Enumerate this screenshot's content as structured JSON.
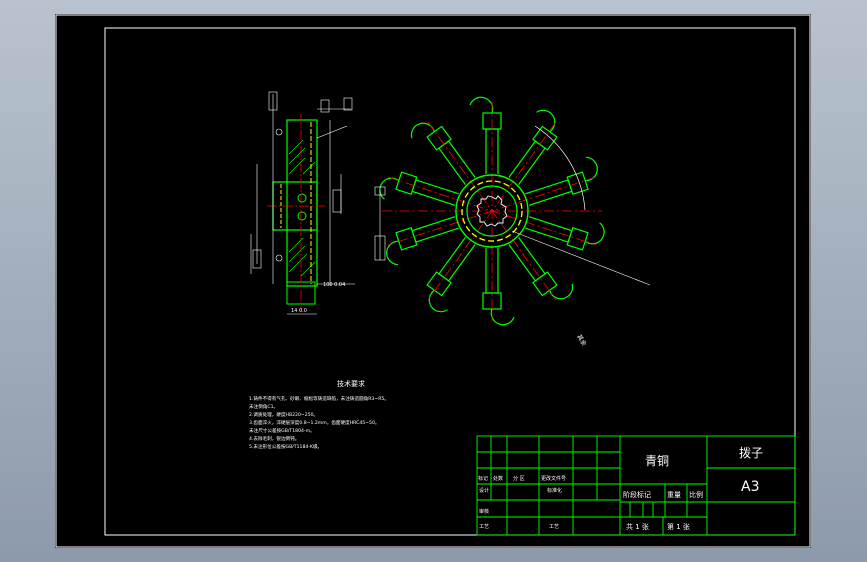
{
  "title_block": {
    "material": "青铜",
    "part_name": "拨子",
    "sheet_size": "A3",
    "labels": {
      "marking": "标记",
      "quantity": "处数",
      "zone": "分 区",
      "change_doc": "更改文件号",
      "design": "设计",
      "standardization": "标准化",
      "check": "审核",
      "process": "工艺",
      "stage_mark": "阶段标记",
      "weight": "重量",
      "scale": "比例",
      "total_sheets": "共 1 张",
      "sheet_no": "第 1 张"
    }
  },
  "notes": {
    "heading": "技术要求",
    "lines": [
      "1.铸件不得有气孔、砂眼、缩松等铸造缺陷，未注铸造圆角R3~R5。",
      "  未注倒角C1。",
      "2.调质处理，硬度HB220~250。",
      "3.齿面淬火，淬硬层深度0.8~1.2mm，齿面硬度HRC45~50。",
      "  未注尺寸公差按GB/T1804-m。",
      "4.去除毛刺，锐边倒钝。",
      "5.未注形位公差按GB/T1184-K级。"
    ]
  },
  "colors": {
    "background": "#000000",
    "outline": "#00ff00",
    "hidden": "#ffff00",
    "centerline": "#ff0000",
    "dimension": "#ffffff"
  }
}
